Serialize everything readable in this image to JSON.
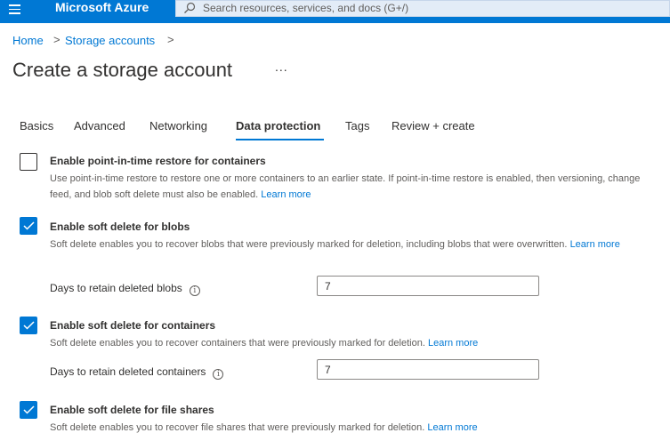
{
  "topbar": {
    "brand": "Microsoft Azure",
    "search_placeholder": "Search resources, services, and docs (G+/)",
    "color": "#0078d4"
  },
  "breadcrumb": {
    "items": [
      "Home",
      "Storage accounts"
    ],
    "separator": ">"
  },
  "page": {
    "title": "Create a storage account",
    "more": "..."
  },
  "tabs": [
    {
      "label": "Basics",
      "active": false
    },
    {
      "label": "Advanced",
      "active": false
    },
    {
      "label": "Networking",
      "active": false
    },
    {
      "label": "Data protection",
      "active": true
    },
    {
      "label": "Tags",
      "active": false
    },
    {
      "label": "Review + create",
      "active": false
    }
  ],
  "options": {
    "pitr": {
      "title": "Enable point-in-time restore for containers",
      "checked": false,
      "description": "Use point-in-time restore to restore one or more containers to an earlier state. If point-in-time restore is enabled, then versioning, change feed, and blob soft delete must also be enabled.",
      "link": "Learn more"
    },
    "blobs": {
      "title": "Enable soft delete for blobs",
      "checked": true,
      "description": "Soft delete enables you to recover blobs that were previously marked for deletion, including blobs that were overwritten.",
      "link": "Learn more",
      "retain_label": "Days to retain deleted blobs",
      "retain_value": "7"
    },
    "containers": {
      "title": "Enable soft delete for containers",
      "checked": true,
      "description": "Soft delete enables you to recover containers that were previously marked for deletion.",
      "link": "Learn more",
      "retain_label": "Days to retain deleted containers",
      "retain_value": "7"
    },
    "fileshares": {
      "title": "Enable soft delete for file shares",
      "checked": true,
      "description": "Soft delete enables you to recover file shares that were previously marked for deletion.",
      "link": "Learn more"
    }
  },
  "icons": {
    "menu": "hamburger-icon",
    "search": "search-icon",
    "info": "info-icon",
    "check": "checkmark-icon",
    "chevron": "chevron-right-icon"
  }
}
